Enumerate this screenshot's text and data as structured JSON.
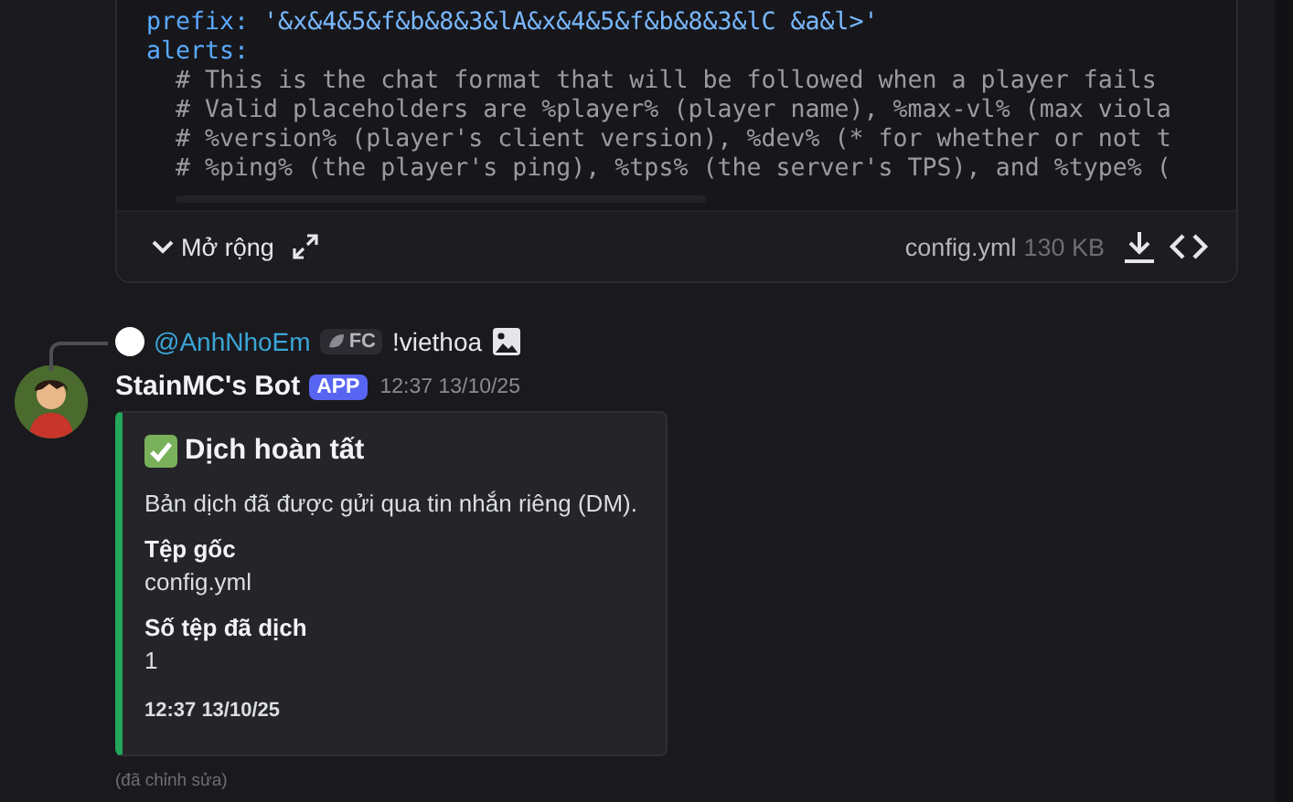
{
  "code_file": {
    "lines": [
      {
        "kind": "entry",
        "key": "prefix:",
        "value": "'&x&4&5&f&b&8&3&lA&x&4&5&f&b&8&3&lC &a&l>'"
      },
      {
        "kind": "entry",
        "key": "alerts:"
      },
      {
        "kind": "comment",
        "text": "# This is the chat format that will be followed when a player fails"
      },
      {
        "kind": "comment",
        "text": "# Valid placeholders are %player% (player name), %max-vl% (max viola"
      },
      {
        "kind": "comment",
        "text": "# %version% (player's client version), %dev% (* for whether or not t"
      },
      {
        "kind": "comment",
        "text": "# %ping% (the player's ping), %tps% (the server's TPS), and %type% ("
      }
    ],
    "expand_label": "Mở rộng",
    "filename": "config.yml",
    "size": "130 KB"
  },
  "reply": {
    "username": "@AnhNhoEm",
    "tag": "FC",
    "content": "!viethoa"
  },
  "message": {
    "author": "StainMC's Bot",
    "badge": "APP",
    "time": "12:37 13/10/25",
    "embed": {
      "title": "Dịch hoàn tất",
      "description": "Bản dịch đã được gửi qua tin nhắn riêng (DM).",
      "fields": [
        {
          "name": "Tệp gốc",
          "value": "config.yml"
        },
        {
          "name": "Số tệp đã dịch",
          "value": "1"
        }
      ],
      "footer": "12:37 13/10/25"
    },
    "edited": "(đã chỉnh sửa)"
  }
}
